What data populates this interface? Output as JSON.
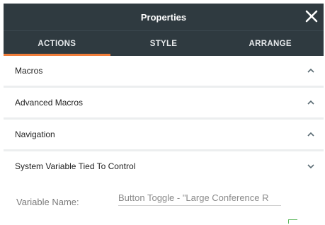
{
  "header": {
    "title": "Properties",
    "close_icon": "close-icon"
  },
  "tabs": [
    {
      "label": "ACTIONS",
      "active": true
    },
    {
      "label": "STYLE",
      "active": false
    },
    {
      "label": "ARRANGE",
      "active": false
    }
  ],
  "sections": [
    {
      "label": "Macros",
      "state": "expanded",
      "icon": "chevron-up-icon"
    },
    {
      "label": "Advanced Macros",
      "state": "expanded",
      "icon": "chevron-up-icon"
    },
    {
      "label": "Navigation",
      "state": "expanded",
      "icon": "chevron-up-icon"
    },
    {
      "label": "System Variable Tied To Control",
      "state": "collapsed",
      "icon": "chevron-down-icon"
    }
  ],
  "variable_field": {
    "label": "Variable Name:",
    "value": "Button Toggle - \"Large Conference R"
  },
  "colors": {
    "header_bg": "#2f3a40",
    "tab_indicator": "#f07d3a",
    "chevron": "#5a6b73"
  }
}
